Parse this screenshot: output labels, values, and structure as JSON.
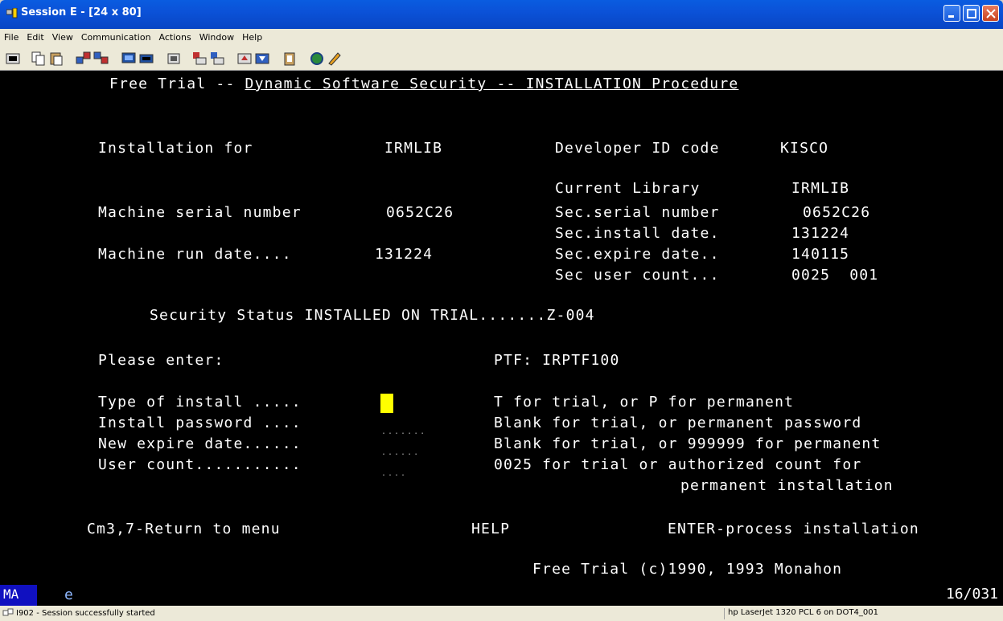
{
  "window": {
    "title": "Session E - [24 x 80]"
  },
  "menu": [
    "File",
    "Edit",
    "View",
    "Communication",
    "Actions",
    "Window",
    "Help"
  ],
  "screen": {
    "heading_prefix": "Free Trial -- ",
    "heading_underlined": "Dynamic Software Security -- INSTALLATION Procedure",
    "installation_for_label": "Installation for",
    "installation_for_value": "IRMLIB",
    "developer_id_label": "Developer ID code",
    "developer_id_value": "KISCO",
    "current_library_label": "Current Library",
    "current_library_value": "IRMLIB",
    "machine_serial_label": "Machine serial number",
    "machine_serial_value": "0652C26",
    "sec_serial_label": "Sec.serial number",
    "sec_serial_value": "0652C26",
    "sec_install_label": "Sec.install date.",
    "sec_install_value": "131224",
    "machine_run_label": "Machine run date....",
    "machine_run_value": "131224",
    "sec_expire_label": "Sec.expire date..",
    "sec_expire_value": "140115",
    "sec_user_count_label": "Sec user count...",
    "sec_user_count_value": "0025  001",
    "security_status": "Security Status INSTALLED ON TRIAL.......Z-004",
    "please_enter": "Please enter:",
    "ptf": "PTF: IRPTF100",
    "fields": [
      {
        "label": "Type of install .....",
        "hint": "T for trial, or P for permanent",
        "value": ""
      },
      {
        "label": "Install password ....",
        "hint": "Blank for trial, or permanent password",
        "value": "......."
      },
      {
        "label": "New expire date......",
        "hint": "Blank for trial, or 999999 for permanent",
        "value": "......"
      },
      {
        "label": "User count...........",
        "hint": "0025 for trial or authorized count for",
        "value": "...."
      }
    ],
    "hint_continued": "permanent installation",
    "fkey_return": "Cm3,7-Return to menu",
    "fkey_help": "HELP",
    "fkey_enter": "ENTER-process installation",
    "copyright": "Free Trial (c)1990, 1993 Monahon"
  },
  "oia": {
    "mode": "MA",
    "indicator": "e",
    "cursor_position": "16/031"
  },
  "status": {
    "message": "I902 - Session successfully started",
    "printer": "hp LaserJet 1320 PCL 6 on DOT4_001"
  }
}
